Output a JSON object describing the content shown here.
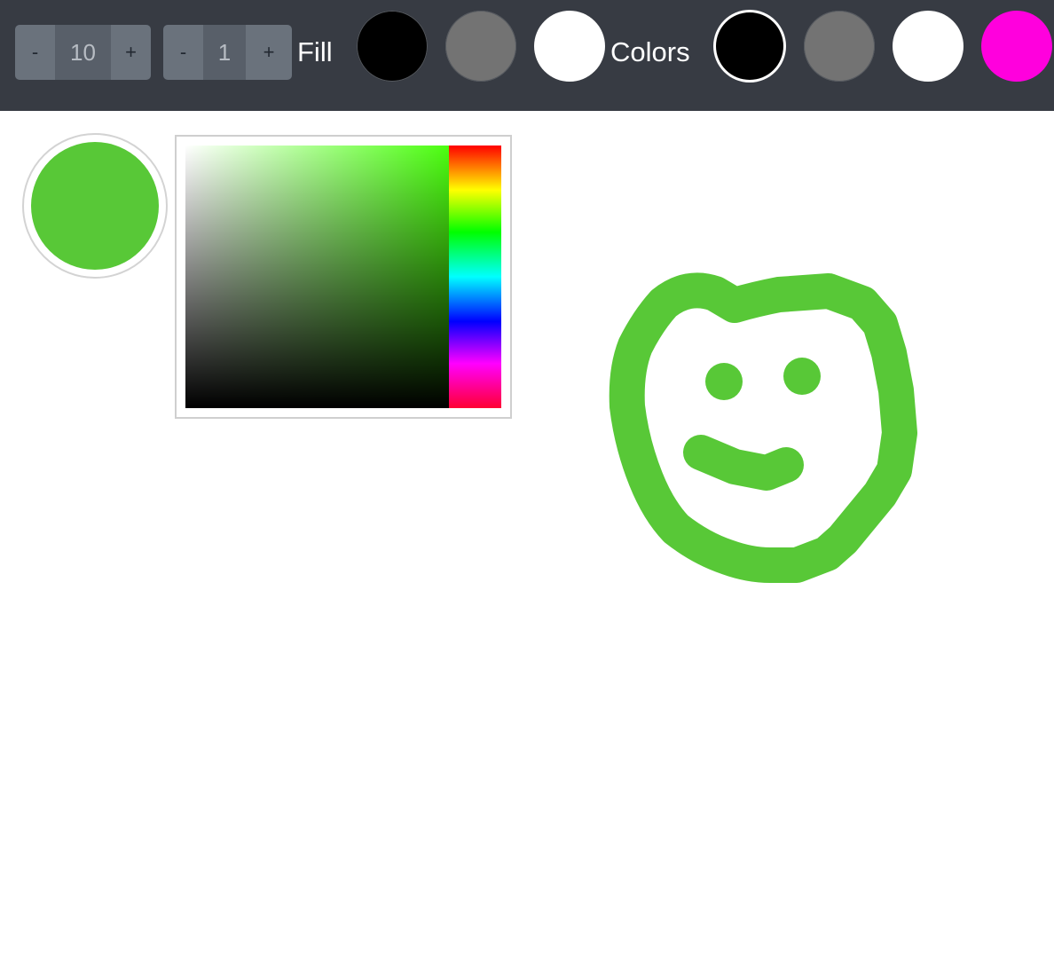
{
  "toolbar": {
    "size_stepper": {
      "decrement_label": "-",
      "value": "10",
      "increment_label": "+"
    },
    "opacity_stepper": {
      "decrement_label": "-",
      "value": "1",
      "increment_label": "+"
    },
    "fill_label": "Fill",
    "fill_swatches": [
      {
        "name": "black",
        "color": "#000000"
      },
      {
        "name": "gray",
        "color": "#737373"
      },
      {
        "name": "white",
        "color": "#ffffff"
      }
    ],
    "colors_label": "Colors",
    "color_swatches": [
      {
        "name": "black",
        "color": "#000000",
        "selected": true
      },
      {
        "name": "gray",
        "color": "#737373",
        "selected": false
      },
      {
        "name": "white",
        "color": "#ffffff",
        "selected": false
      },
      {
        "name": "magenta",
        "color": "#ff00dd",
        "selected": false
      }
    ]
  },
  "current_color": "#58c837",
  "color_picker": {
    "hue_color": "#4cff10"
  },
  "drawing": {
    "stroke_color": "#58c837",
    "subject": "smiley face"
  }
}
